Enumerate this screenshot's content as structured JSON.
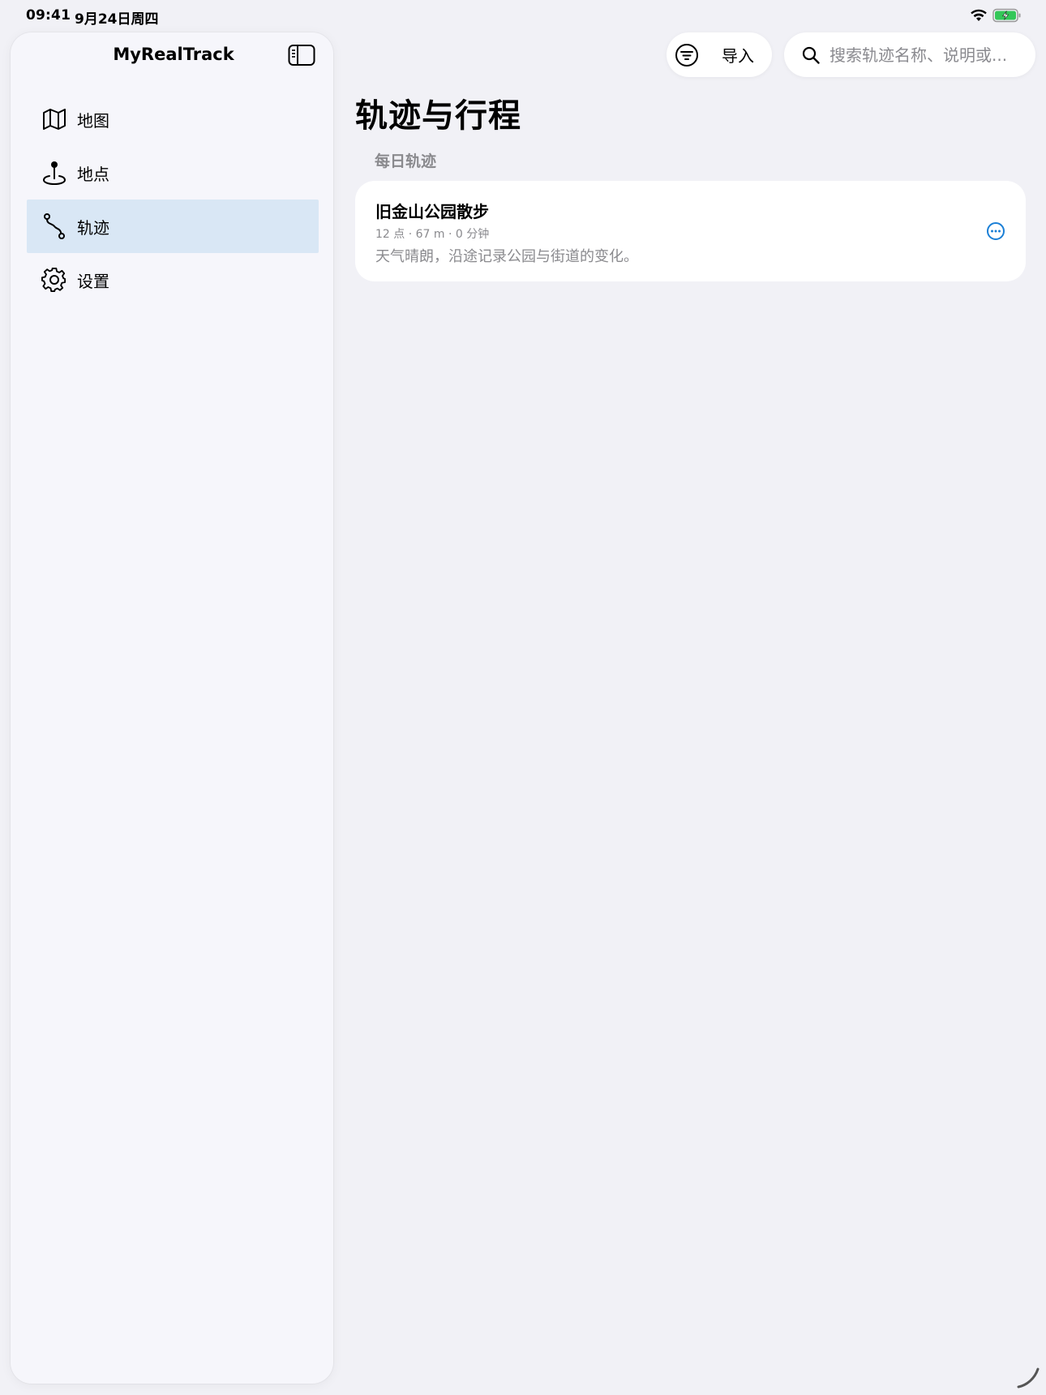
{
  "status_bar": {
    "time": "09:41",
    "date": "9月24日周四"
  },
  "sidebar": {
    "title": "MyRealTrack",
    "items": [
      {
        "label": "地图",
        "icon": "map-icon",
        "active": false
      },
      {
        "label": "地点",
        "icon": "pin-icon",
        "active": false
      },
      {
        "label": "轨迹",
        "icon": "route-icon",
        "active": true
      },
      {
        "label": "设置",
        "icon": "gear-icon",
        "active": false
      }
    ]
  },
  "toolbar": {
    "import_label": "导入",
    "search_placeholder": "搜索轨迹名称、说明或..."
  },
  "main": {
    "title": "轨迹与行程",
    "section_header": "每日轨迹",
    "tracks": [
      {
        "title": "旧金山公园散步",
        "meta": "12 点 · 67 m · 0 分钟",
        "description": "天气晴朗，沿途记录公园与街道的变化。"
      }
    ]
  },
  "colors": {
    "accent": "#1a7fd6",
    "selection": "#d9e7f5",
    "battery": "#34c759"
  }
}
